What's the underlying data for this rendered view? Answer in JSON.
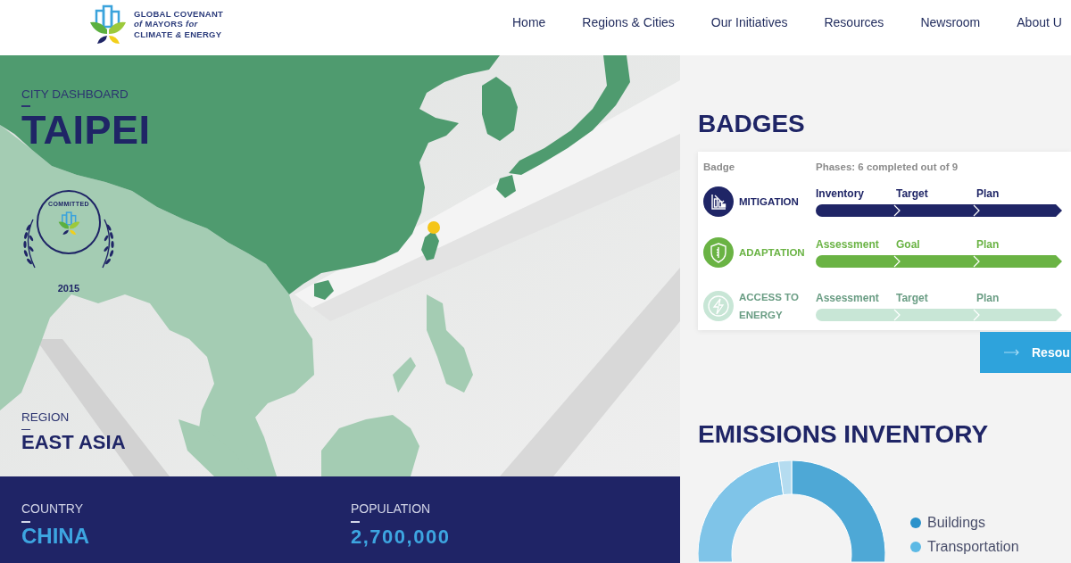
{
  "header": {
    "logo_lines": [
      "GLOBAL COVENANT",
      "*of* MAYORS *for*",
      "CLIMATE *&* ENERGY"
    ],
    "nav": [
      {
        "label": "Home"
      },
      {
        "label": "Regions & Cities"
      },
      {
        "label": "Our Initiatives"
      },
      {
        "label": "Resources"
      },
      {
        "label": "Newsroom"
      },
      {
        "label": "About U"
      }
    ]
  },
  "city": {
    "eyebrow": "CITY DASHBOARD",
    "name": "TAIPEI",
    "seal": {
      "label": "COMMITTED",
      "year": "2015"
    },
    "region": {
      "label": "REGION",
      "value": "EAST ASIA"
    }
  },
  "stats": [
    {
      "label": "COUNTRY",
      "value": "CHINA"
    },
    {
      "label": "POPULATION",
      "value": "2,700,000"
    }
  ],
  "badges": {
    "title": "BADGES",
    "columns": [
      "Badge",
      "Phases: 6 completed out of 9"
    ],
    "items": [
      {
        "kind": "mitigation",
        "name": "MITIGATION",
        "color": "#1f2566",
        "achieved": true,
        "phases": [
          "Inventory",
          "Target",
          "Plan"
        ]
      },
      {
        "kind": "adaptation",
        "name": "ADAPTATION",
        "color": "#6ab344",
        "achieved": true,
        "phases": [
          "Assessment",
          "Goal",
          "Plan"
        ]
      },
      {
        "kind": "energy",
        "name": "ACCESS TO ENERGY",
        "color": "#c8e6d6",
        "achieved": false,
        "phases": [
          "Assessment",
          "Target",
          "Plan"
        ]
      }
    ],
    "button": {
      "label": "Resou"
    }
  },
  "emissions": {
    "title": "EMISSIONS INVENTORY",
    "legend": [
      {
        "label": "Buildings",
        "color": "#2a92cb"
      },
      {
        "label": "Transportation",
        "color": "#5cb9e5"
      }
    ]
  }
}
